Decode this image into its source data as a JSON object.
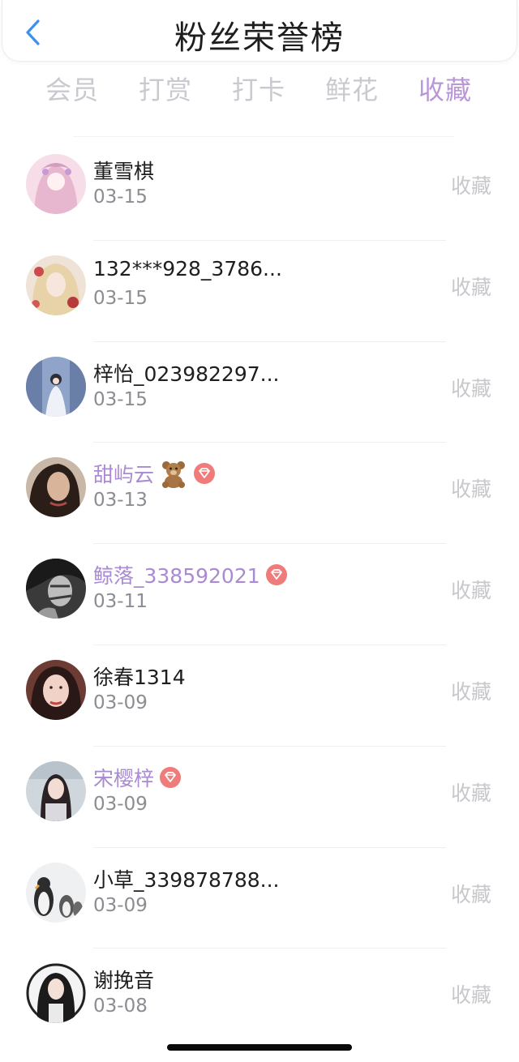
{
  "header": {
    "title": "粉丝荣誉榜"
  },
  "tabs": [
    {
      "label": "会员",
      "active": false
    },
    {
      "label": "打赏",
      "active": false
    },
    {
      "label": "打卡",
      "active": false
    },
    {
      "label": "鲜花",
      "active": false
    },
    {
      "label": "收藏",
      "active": true
    }
  ],
  "colors": {
    "accent": "#b996d8",
    "vip_name": "#a98ad3",
    "badge": "#ef7b7b",
    "back": "#3d8ff0"
  },
  "fans": [
    {
      "name": "董雪棋",
      "date": "03-15",
      "action": "收藏",
      "vip": false,
      "emoji": null
    },
    {
      "name": "132***928_3786...",
      "date": "03-15",
      "action": "收藏",
      "vip": false,
      "emoji": null
    },
    {
      "name": "梓怡_023982297...",
      "date": "03-15",
      "action": "收藏",
      "vip": false,
      "emoji": null
    },
    {
      "name": "甜屿云",
      "date": "03-13",
      "action": "收藏",
      "vip": true,
      "emoji": "teddy-bear-icon"
    },
    {
      "name": "鲸落_338592021",
      "date": "03-11",
      "action": "收藏",
      "vip": true,
      "emoji": null
    },
    {
      "name": "徐春1314",
      "date": "03-09",
      "action": "收藏",
      "vip": false,
      "emoji": null
    },
    {
      "name": "宋樱梓",
      "date": "03-09",
      "action": "收藏",
      "vip": true,
      "emoji": null
    },
    {
      "name": "小草_339878788...",
      "date": "03-09",
      "action": "收藏",
      "vip": false,
      "emoji": null
    },
    {
      "name": "谢挽音",
      "date": "03-08",
      "action": "收藏",
      "vip": false,
      "emoji": null
    }
  ]
}
